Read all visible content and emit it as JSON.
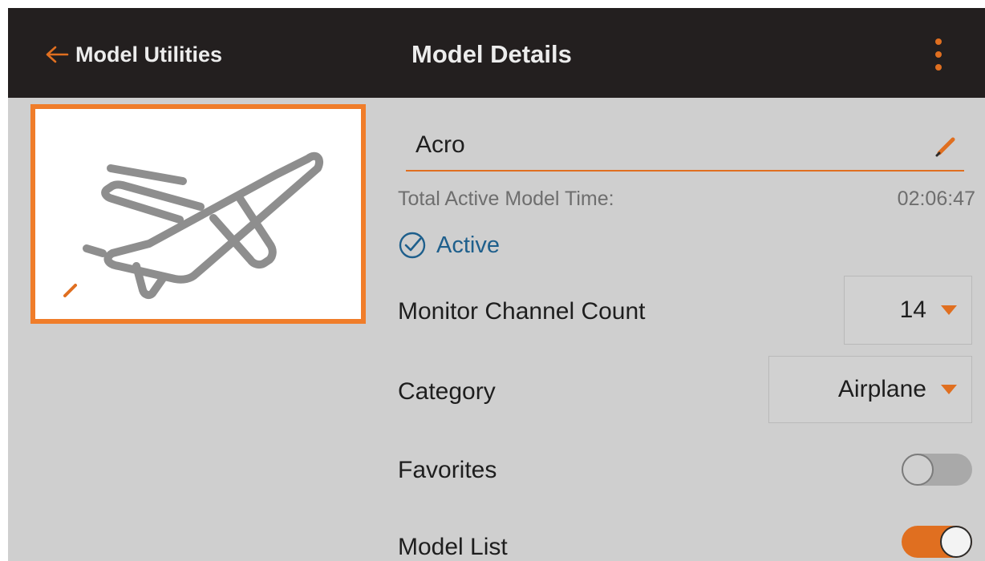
{
  "header": {
    "back_label": "Model Utilities",
    "title": "Model Details",
    "back_icon": "arrow-left-icon",
    "menu_icon": "more-vertical-icon"
  },
  "model_image": {
    "icon": "airplane-icon",
    "edit_icon": "pencil-icon"
  },
  "model": {
    "name": "Acro",
    "name_edit_icon": "pencil-icon",
    "time_label": "Total Active Model Time:",
    "time_value": "02:06:47",
    "status_icon": "check-circle-icon",
    "status": "Active"
  },
  "settings": {
    "monitor_channel_count": {
      "label": "Monitor Channel Count",
      "value": "14"
    },
    "category": {
      "label": "Category",
      "value": "Airplane"
    },
    "favorites": {
      "label": "Favorites",
      "enabled": false
    },
    "model_list": {
      "label": "Model List",
      "enabled": true
    }
  },
  "colors": {
    "accent": "#e06f20",
    "header_bg": "#231f1f",
    "panel_bg": "#cfcfcf",
    "highlight_border": "#f07d2a",
    "active_text": "#1e5f8c"
  }
}
